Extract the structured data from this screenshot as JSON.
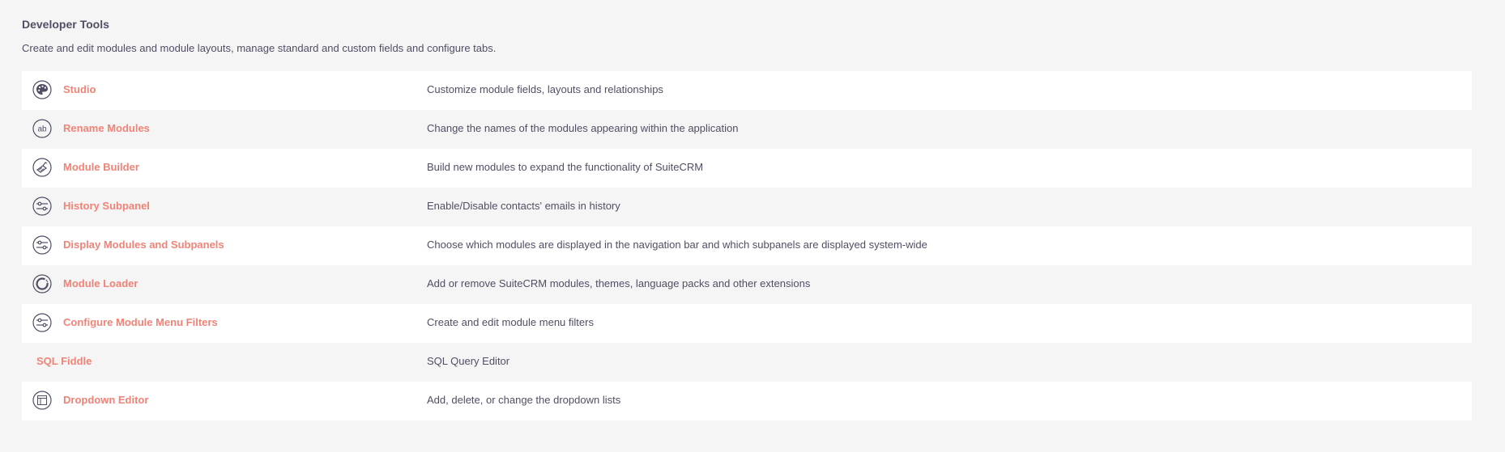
{
  "panel": {
    "title": "Developer Tools",
    "description": "Create and edit modules and module layouts, manage standard and custom fields and configure tabs."
  },
  "colors": {
    "link": "#f08377",
    "text": "#534d64",
    "row_alt": "#ffffff",
    "background": "#f5f5f5"
  },
  "rows": [
    {
      "label": "Studio",
      "description": "Customize module fields, layouts and relationships",
      "icon": "palette-icon"
    },
    {
      "label": "Rename Modules",
      "description": "Change the names of the modules appearing within the application",
      "icon": "rename-ab-icon"
    },
    {
      "label": "Module Builder",
      "description": "Build new modules to expand the functionality of SuiteCRM",
      "icon": "trowel-icon"
    },
    {
      "label": "History Subpanel",
      "description": "Enable/Disable contacts' emails in history",
      "icon": "sliders-icon"
    },
    {
      "label": "Display Modules and Subpanels",
      "description": "Choose which modules are displayed in the navigation bar and which subpanels are displayed system-wide",
      "icon": "sliders-icon"
    },
    {
      "label": "Module Loader",
      "description": "Add or remove SuiteCRM modules, themes, language packs and other extensions",
      "icon": "loader-icon"
    },
    {
      "label": "Configure Module Menu Filters",
      "description": "Create and edit module menu filters",
      "icon": "sliders-icon"
    },
    {
      "label": "SQL Fiddle",
      "description": "SQL Query Editor",
      "icon": ""
    },
    {
      "label": "Dropdown Editor",
      "description": "Add, delete, or change the dropdown lists",
      "icon": "dropdown-list-icon"
    }
  ]
}
